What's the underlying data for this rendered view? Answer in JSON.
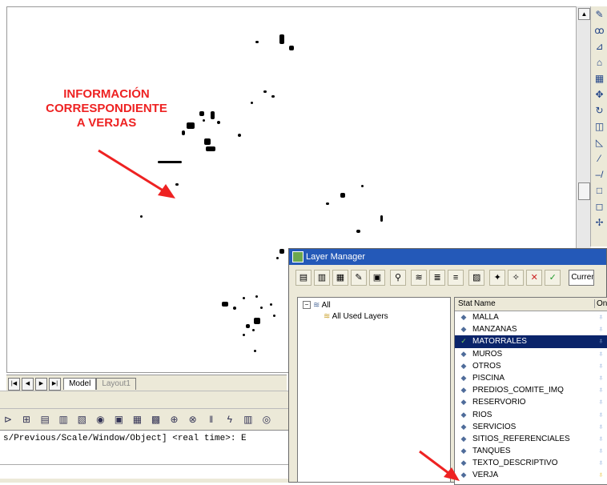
{
  "annotation": {
    "line1": "INFORMACIÓN",
    "line2": "CORRESPONDIENTE",
    "line3": "A VERJAS",
    "color": "#ee2222"
  },
  "tabs": {
    "model": "Model",
    "layout1": "Layout1"
  },
  "command": {
    "text": "s/Previous/Scale/Window/Object] <real time>: E"
  },
  "layer_manager": {
    "title": "Layer Manager",
    "current_label": "Curren",
    "tree": {
      "all": "All",
      "all_used": "All Used Layers"
    },
    "columns": {
      "status": "Stat",
      "name": "Name",
      "on": "On"
    },
    "layers": [
      {
        "name": "MALLA",
        "selected": false
      },
      {
        "name": "MANZANAS",
        "selected": false
      },
      {
        "name": "MATORRALES",
        "selected": true
      },
      {
        "name": "MUROS",
        "selected": false
      },
      {
        "name": "OTROS",
        "selected": false
      },
      {
        "name": "PISCINA",
        "selected": false
      },
      {
        "name": "PREDIOS_COMITE_IMQ",
        "selected": false
      },
      {
        "name": "RESERVORIO",
        "selected": false
      },
      {
        "name": "RIOS",
        "selected": false
      },
      {
        "name": "SERVICIOS",
        "selected": false
      },
      {
        "name": "SITIOS_REFERENCIALES",
        "selected": false
      },
      {
        "name": "TANQUES",
        "selected": false
      },
      {
        "name": "TEXTO_DESCRIPTIVO",
        "selected": false
      },
      {
        "name": "VERJA",
        "selected": false
      }
    ]
  },
  "colors": {
    "titlebar": "#2459b8",
    "selection": "#0a246a",
    "arrow": "#ee2222"
  }
}
